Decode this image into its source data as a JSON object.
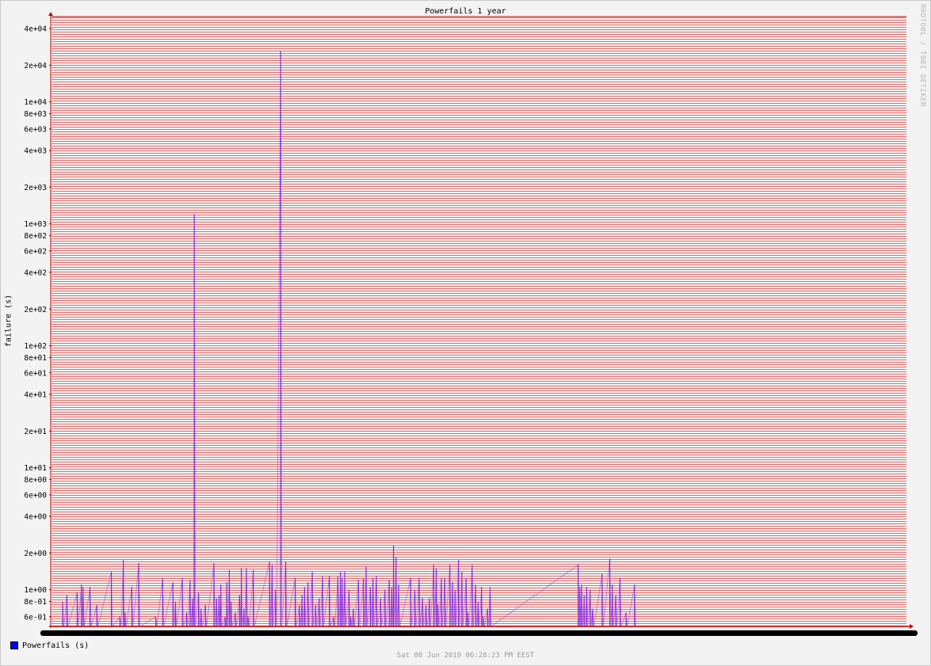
{
  "chart_data": {
    "type": "line",
    "title": "Powerfails 1 year",
    "ylabel": "failure (s)",
    "xlabel": "",
    "yscale": "log",
    "ylim": [
      0.5,
      50000
    ],
    "grid": true,
    "y_ticks": [
      "4e+04",
      "2e+04",
      "1e+04",
      "8e+03",
      "6e+03",
      "4e+03",
      "2e+03",
      "1e+03",
      "8e+02",
      "6e+02",
      "4e+02",
      "2e+02",
      "1e+02",
      "8e+01",
      "6e+01",
      "4e+01",
      "2e+01",
      "1e+01",
      "8e+00",
      "6e+00",
      "4e+00",
      "2e+00",
      "1e+00",
      "8e-01",
      "6e-01"
    ],
    "y_tick_values": [
      40000,
      20000,
      10000,
      8000,
      6000,
      4000,
      2000,
      1000,
      800,
      600,
      400,
      200,
      100,
      80,
      60,
      40,
      20,
      10,
      8,
      6,
      4,
      2,
      1,
      0.8,
      0.6
    ],
    "x_range": [
      0,
      100
    ],
    "series": [
      {
        "name": "Powerfails (s)",
        "color": "#0000ff",
        "points": [
          [
            1.3,
            0.8
          ],
          [
            1.8,
            0.9
          ],
          [
            3.0,
            0.95
          ],
          [
            3.5,
            1.1
          ],
          [
            3.7,
            1.05
          ],
          [
            4.5,
            1.05
          ],
          [
            5.3,
            0.75
          ],
          [
            7.0,
            1.4
          ],
          [
            8.0,
            0.6
          ],
          [
            8.4,
            1.75
          ],
          [
            8.6,
            0.65
          ],
          [
            9.4,
            1.05
          ],
          [
            10.2,
            1.65
          ],
          [
            12.2,
            0.6
          ],
          [
            13.0,
            1.25
          ],
          [
            14.2,
            1.15
          ],
          [
            14.5,
            0.8
          ],
          [
            15.3,
            1.25
          ],
          [
            15.8,
            0.65
          ],
          [
            16.2,
            1.2
          ],
          [
            16.5,
            0.85
          ],
          [
            16.7,
            1200
          ],
          [
            17.2,
            0.95
          ],
          [
            17.5,
            0.7
          ],
          [
            18.0,
            0.75
          ],
          [
            19.0,
            1.65
          ],
          [
            19.3,
            0.85
          ],
          [
            19.6,
            0.9
          ],
          [
            19.8,
            1.1
          ],
          [
            20.3,
            0.6
          ],
          [
            20.5,
            1.15
          ],
          [
            20.8,
            1.45
          ],
          [
            21.0,
            0.8
          ],
          [
            21.5,
            0.65
          ],
          [
            22.0,
            0.9
          ],
          [
            22.2,
            1.5
          ],
          [
            22.5,
            0.7
          ],
          [
            22.8,
            1.5
          ],
          [
            23.0,
            0.6
          ],
          [
            23.6,
            1.45
          ],
          [
            25.5,
            1.7
          ],
          [
            25.8,
            1.6
          ],
          [
            26.2,
            1.0
          ],
          [
            26.8,
            26000
          ],
          [
            27.4,
            1.7
          ],
          [
            28.5,
            1.25
          ],
          [
            29.0,
            0.75
          ],
          [
            29.3,
            0.9
          ],
          [
            29.6,
            1.05
          ],
          [
            30.0,
            1.15
          ],
          [
            30.5,
            1.4
          ],
          [
            30.9,
            0.75
          ],
          [
            31.3,
            0.85
          ],
          [
            31.7,
            1.3
          ],
          [
            32.5,
            1.3
          ],
          [
            33.0,
            0.6
          ],
          [
            33.5,
            1.3
          ],
          [
            33.8,
            1.4
          ],
          [
            34.0,
            1.25
          ],
          [
            34.3,
            1.4
          ],
          [
            34.8,
            1.0
          ],
          [
            35.0,
            0.6
          ],
          [
            35.3,
            0.7
          ],
          [
            35.9,
            1.2
          ],
          [
            36.5,
            1.25
          ],
          [
            36.8,
            1.55
          ],
          [
            37.3,
            1.05
          ],
          [
            37.6,
            1.25
          ],
          [
            38.0,
            1.3
          ],
          [
            38.5,
            0.85
          ],
          [
            39.0,
            1.0
          ],
          [
            39.5,
            1.2
          ],
          [
            39.8,
            1.05
          ],
          [
            40.0,
            2.3
          ],
          [
            40.3,
            1.85
          ],
          [
            40.6,
            1.1
          ],
          [
            42.0,
            1.25
          ],
          [
            42.5,
            1.0
          ],
          [
            43.0,
            1.25
          ],
          [
            43.4,
            0.85
          ],
          [
            43.8,
            0.75
          ],
          [
            44.2,
            0.85
          ],
          [
            44.7,
            1.6
          ],
          [
            45.0,
            1.5
          ],
          [
            45.2,
            0.75
          ],
          [
            45.6,
            1.25
          ],
          [
            46.0,
            1.25
          ],
          [
            46.6,
            1.6
          ],
          [
            46.9,
            1.15
          ],
          [
            47.2,
            1.0
          ],
          [
            47.6,
            1.75
          ],
          [
            48.0,
            1.4
          ],
          [
            48.5,
            1.25
          ],
          [
            48.7,
            0.65
          ],
          [
            49.2,
            1.6
          ],
          [
            49.6,
            1.1
          ],
          [
            49.9,
            0.8
          ],
          [
            50.3,
            1.05
          ],
          [
            50.5,
            0.6
          ],
          [
            51.0,
            0.7
          ],
          [
            51.3,
            1.05
          ],
          [
            61.6,
            1.6
          ],
          [
            61.8,
            1.05
          ],
          [
            62.0,
            1.1
          ],
          [
            62.3,
            0.9
          ],
          [
            62.6,
            1.05
          ],
          [
            63.0,
            1.0
          ],
          [
            63.3,
            0.7
          ],
          [
            64.4,
            1.35
          ],
          [
            65.3,
            1.8
          ],
          [
            65.6,
            1.1
          ],
          [
            66.0,
            0.9
          ],
          [
            66.5,
            1.25
          ],
          [
            67.2,
            0.65
          ],
          [
            68.2,
            1.1
          ]
        ]
      }
    ],
    "legend": [
      "Powerfails (s)"
    ],
    "legend_position": "bottom-left",
    "background_grid_color": "#e05555",
    "axis_color": "#c00000"
  },
  "footer": {
    "timestamp": "Sat 08 Jun 2019 06:28:23 PM EEST",
    "watermark": "RRDTOOL / TOBI OETIKER"
  }
}
